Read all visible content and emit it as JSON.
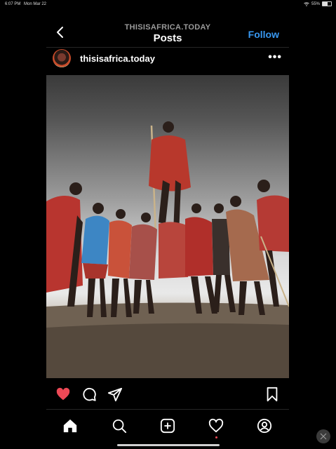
{
  "status": {
    "time": "6:07 PM",
    "date": "Mon Mar 22",
    "battery": "55%",
    "battery_level": 0.55
  },
  "header": {
    "subtitle": "THISISAFRICA.TODAY",
    "title": "Posts",
    "follow_label": "Follow"
  },
  "post": {
    "username": "thisisafrica.today",
    "liked": true
  },
  "colors": {
    "accent": "#3897f0",
    "like": "#ed4956",
    "background": "#000000"
  },
  "icons": {
    "back": "chevron-left-icon",
    "more": "more-horizontal-icon",
    "like": "heart-icon",
    "comment": "comment-icon",
    "share": "send-icon",
    "save": "bookmark-icon",
    "home": "home-icon",
    "search": "search-icon",
    "create": "plus-square-icon",
    "activity": "heart-outline-icon",
    "profile": "profile-icon"
  }
}
